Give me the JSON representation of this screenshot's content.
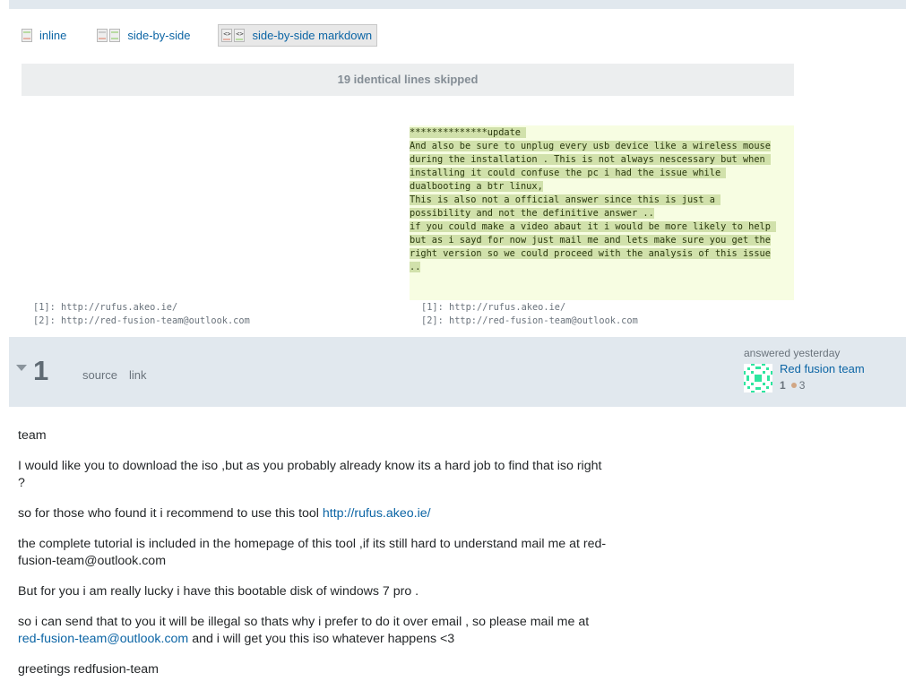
{
  "diff_modes": [
    {
      "label": "inline",
      "icon": "inline-diff-icon",
      "active": false
    },
    {
      "label": "side-by-side",
      "icon": "side-by-side-diff-icon",
      "active": false
    },
    {
      "label": "side-by-side markdown",
      "icon": "side-by-side-markdown-icon",
      "active": true
    }
  ],
  "skipped": {
    "count": "19",
    "label": " identical lines skipped"
  },
  "added_lines": [
    "**************update ",
    "And also be sure to unplug every usb device like a wireless mouse",
    "during the installation . This is not always nescessary but when ",
    "installing it could confuse the pc i had the issue while ",
    "dualbooting a btr linux,",
    "This is also not a official answer since this is just a ",
    "possibility and not the definitive answer ..",
    "if you could make a video abaut it i would be more likely to help ",
    "but as i sayd for now just mail me and lets make sure you get the",
    "right version so we could proceed with the analysis of this issue",
    ".."
  ],
  "references": {
    "left": [
      "[1]: http://rufus.akeo.ie/",
      "[2]: http://red-fusion-team@outlook.com"
    ],
    "right": [
      "[1]: http://rufus.akeo.ie/",
      "[2]: http://red-fusion-team@outlook.com"
    ]
  },
  "answer_bar": {
    "vote_count": "1",
    "source_label": "source",
    "link_label": "link",
    "answered_label": "answered yesterday",
    "user_name": "Red fusion team",
    "reputation": "1",
    "bronze_badges": "3",
    "colors": {
      "bar_bg": "#e1e8ee",
      "avatar": "#2ee6a0",
      "link": "#0c65a5"
    }
  },
  "body": {
    "p1": "team",
    "p2": "I would like you to download the iso ,but as you probably already know its a hard job to find that iso right ?",
    "p3_text": "so for those who found it i recommend to use this tool ",
    "p3_link": "http://rufus.akeo.ie/",
    "p4": "the complete tutorial is included in the homepage of this tool ,if its still hard to understand mail me at red-fusion-team@outlook.com",
    "p5": "But for you i am really lucky i have this bootable disk of windows 7 pro .",
    "p6_text": "so i can send that to you it will be illegal so thats why i prefer to do it over email , so please mail me at ",
    "p6_link": "red-fusion-team@outlook.com",
    "p6_tail": " and i will get you this iso whatever happens <3",
    "p7": "greetings redfusion-team"
  }
}
